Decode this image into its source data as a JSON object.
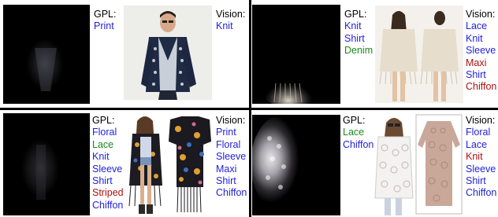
{
  "colors": {
    "correct": "#1f1fdc",
    "missed": "#1a8a1a",
    "wrong": "#b01010"
  },
  "panels": [
    {
      "gpl_header": "GPL:",
      "vision_header": "Vision:",
      "gpl_words": [
        {
          "text": "Print",
          "status": "correct"
        }
      ],
      "vision_words": [
        {
          "text": "Knit",
          "status": "correct"
        }
      ]
    },
    {
      "gpl_header": "GPL:",
      "vision_header": "Vision:",
      "gpl_words": [
        {
          "text": "Knit",
          "status": "correct"
        },
        {
          "text": "Shirt",
          "status": "correct"
        },
        {
          "text": "Denim",
          "status": "missed"
        }
      ],
      "vision_words": [
        {
          "text": "Lace",
          "status": "correct"
        },
        {
          "text": "Knit",
          "status": "correct"
        },
        {
          "text": "Sleeve",
          "status": "correct"
        },
        {
          "text": "Maxi",
          "status": "wrong"
        },
        {
          "text": "Shirt",
          "status": "correct"
        },
        {
          "text": "Chiffon",
          "status": "wrong"
        }
      ]
    },
    {
      "gpl_header": "GPL:",
      "vision_header": "Vision:",
      "gpl_words": [
        {
          "text": "Floral",
          "status": "correct"
        },
        {
          "text": "Lace",
          "status": "missed"
        },
        {
          "text": "Knit",
          "status": "correct"
        },
        {
          "text": "Sleeve",
          "status": "correct"
        },
        {
          "text": "Shirt",
          "status": "correct"
        },
        {
          "text": "Striped",
          "status": "wrong"
        },
        {
          "text": "Chiffon",
          "status": "correct"
        }
      ],
      "vision_words": [
        {
          "text": "Print",
          "status": "correct"
        },
        {
          "text": "Floral",
          "status": "correct"
        },
        {
          "text": "Sleeve",
          "status": "correct"
        },
        {
          "text": "Maxi",
          "status": "correct"
        },
        {
          "text": "Shirt",
          "status": "correct"
        },
        {
          "text": "Chiffon",
          "status": "correct"
        }
      ]
    },
    {
      "gpl_header": "GPL:",
      "vision_header": "Vision:",
      "gpl_words": [
        {
          "text": "Lace",
          "status": "missed"
        },
        {
          "text": "Chiffon",
          "status": "correct"
        }
      ],
      "vision_words": [
        {
          "text": "Floral",
          "status": "correct"
        },
        {
          "text": "Lace",
          "status": "correct"
        },
        {
          "text": "Knit",
          "status": "wrong"
        },
        {
          "text": "Sleeve",
          "status": "correct"
        },
        {
          "text": "Shirt",
          "status": "correct"
        },
        {
          "text": "Chiffon",
          "status": "correct"
        }
      ]
    }
  ],
  "images": [
    {
      "attention": "dark-attention-map",
      "photo": "man-in-patterned-cardigan"
    },
    {
      "attention": "dark-attention-map",
      "photo": "woman-in-fringed-knit-poncho"
    },
    {
      "attention": "dark-attention-map",
      "photo": "woman-in-floral-fringed-kimono"
    },
    {
      "attention": "dark-attention-map",
      "photo": "woman-in-lace-blouse"
    }
  ]
}
